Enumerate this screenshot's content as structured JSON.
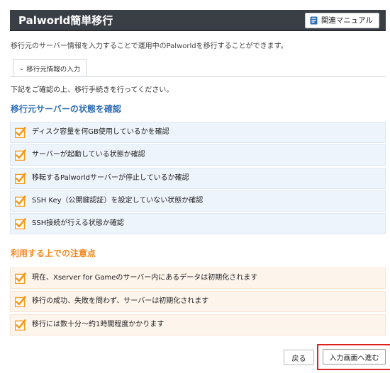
{
  "header": {
    "title": "Palworld簡単移行",
    "manual_button": "関連マニュアル"
  },
  "description": "移行元のサーバー情報を入力することで運用中のPalworldを移行することができます。",
  "tab": {
    "label": "移行元情報の入力"
  },
  "intro": "下記をご確認の上、移行手続きを行ってください。",
  "confirm_section": {
    "title": "移行元サーバーの状態を確認",
    "items": [
      {
        "label": "ディスク容量を何GB使用しているかを確認",
        "checked": true
      },
      {
        "label": "サーバーが起動している状態か確認",
        "checked": true
      },
      {
        "label": "移転するPalworldサーバーが停止しているか確認",
        "checked": true
      },
      {
        "label": "SSH Key（公開鍵認証）を設定していない状態か確認",
        "checked": true
      },
      {
        "label": "SSH接続が行える状態か確認",
        "checked": true
      }
    ]
  },
  "notes_section": {
    "title": "利用する上での注意点",
    "items": [
      {
        "label": "現在、Xserver for Gameのサーバー内にあるデータは初期化されます",
        "checked": true
      },
      {
        "label": "移行の成功、失敗を問わず、サーバーは初期化されます",
        "checked": true
      },
      {
        "label": "移行には数十分～約1時間程度かかります",
        "checked": true
      }
    ]
  },
  "buttons": {
    "back": "戻る",
    "next": "入力画面へ進む"
  },
  "colors": {
    "header_bg": "#3a3e45",
    "section_blue": "#2f6db5",
    "section_orange": "#f08a24",
    "checkbox_orange": "#f39a1e",
    "highlight_red": "#e02020"
  }
}
